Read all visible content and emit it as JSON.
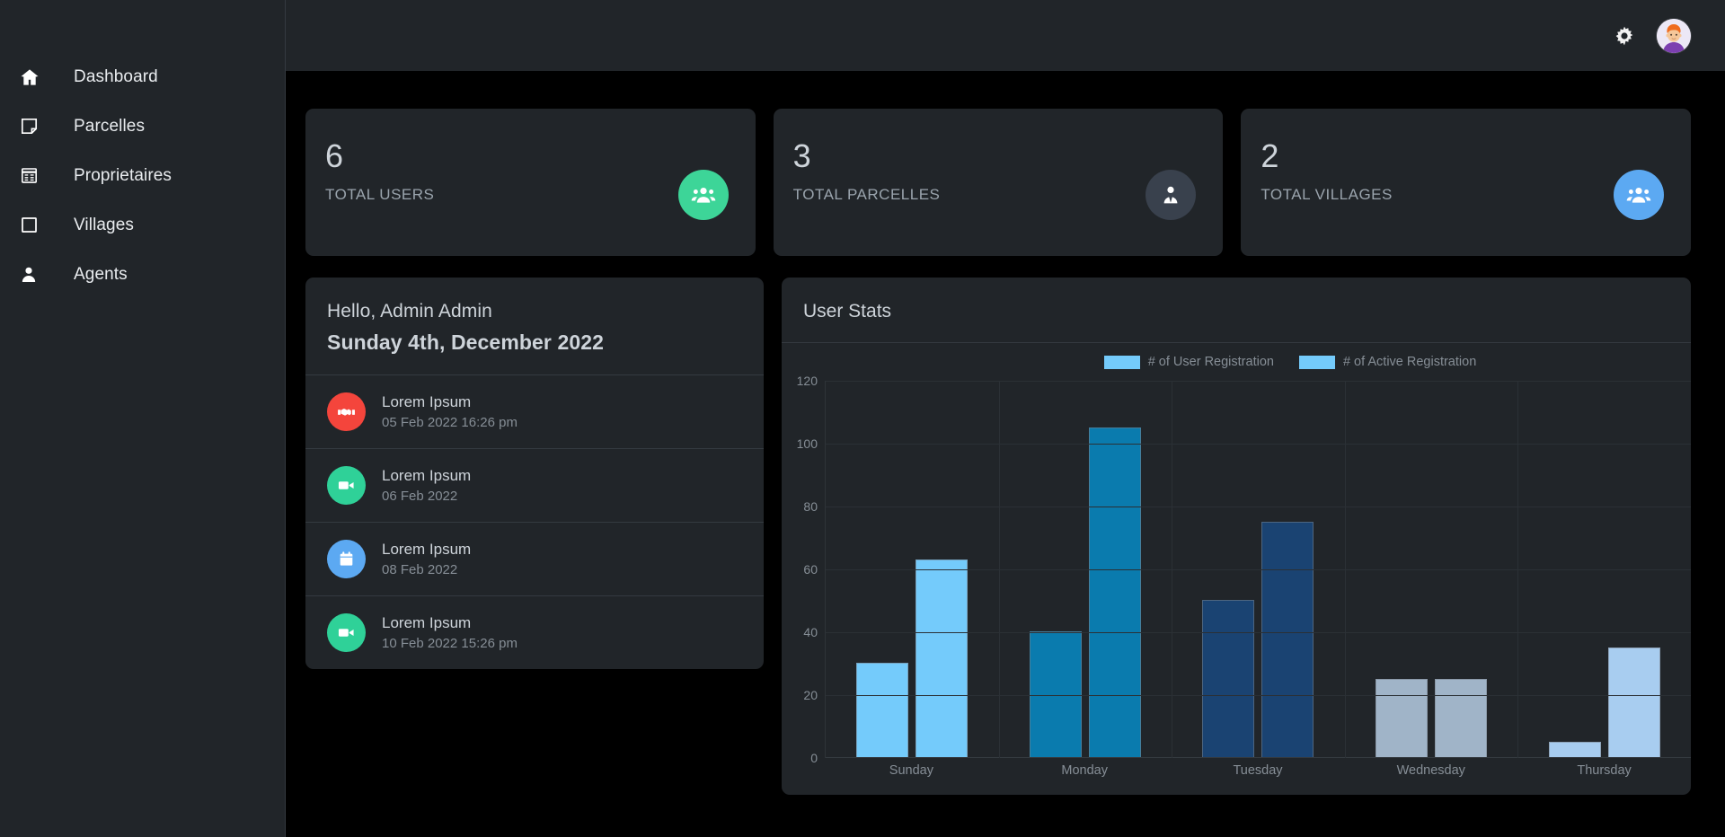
{
  "sidebar": {
    "items": [
      {
        "label": "Dashboard",
        "icon": "home-icon"
      },
      {
        "label": "Parcelles",
        "icon": "note-icon"
      },
      {
        "label": "Proprietaires",
        "icon": "list-card-icon"
      },
      {
        "label": "Villages",
        "icon": "square-icon"
      },
      {
        "label": "Agents",
        "icon": "person-icon"
      }
    ]
  },
  "topbar": {
    "gear_icon": "gear-icon",
    "avatar_icon": "user-avatar"
  },
  "stats": [
    {
      "value": "6",
      "label": "TOTAL USERS",
      "icon": "people-group-icon",
      "badge_color": "#3dd598",
      "icon_color": "#ffffff"
    },
    {
      "value": "3",
      "label": "TOTAL PARCELLES",
      "icon": "business-person-icon",
      "badge_color": "#39414d",
      "icon_color": "#ffffff"
    },
    {
      "value": "2",
      "label": "TOTAL VILLAGES",
      "icon": "people-group-icon",
      "badge_color": "#5ca9f2",
      "icon_color": "#ffffff"
    }
  ],
  "hello": {
    "greeting": "Hello, Admin Admin",
    "date": "Sunday 4th, December 2022",
    "activities": [
      {
        "title": "Lorem Ipsum",
        "time": "05 Feb 2022 16:26 pm",
        "icon": "handshake-icon",
        "badge_color": "#f4453c"
      },
      {
        "title": "Lorem Ipsum",
        "time": "06 Feb 2022",
        "icon": "video-camera-icon",
        "badge_color": "#2fd198"
      },
      {
        "title": "Lorem Ipsum",
        "time": "08 Feb 2022",
        "icon": "calendar-icon",
        "badge_color": "#5ca9f2"
      },
      {
        "title": "Lorem Ipsum",
        "time": "10 Feb 2022 15:26 pm",
        "icon": "video-camera-icon",
        "badge_color": "#2fd198"
      }
    ]
  },
  "chart_data": {
    "type": "bar",
    "title": "User Stats",
    "xlabel": "",
    "ylabel": "",
    "ylim": [
      0,
      120
    ],
    "yticks": [
      0,
      20,
      40,
      60,
      80,
      100,
      120
    ],
    "ytick_labels": [
      "0",
      "20",
      "40",
      "60",
      "80",
      "100",
      "120"
    ],
    "grid": true,
    "legend_position": "top-center",
    "categories": [
      "Sunday",
      "Monday",
      "Tuesday",
      "Wednesday",
      "Thursday"
    ],
    "series": [
      {
        "name": "# of User Registration",
        "values": [
          30,
          40,
          50,
          25,
          5
        ]
      },
      {
        "name": "# of Active Registration",
        "values": [
          63,
          105,
          75,
          25,
          35
        ]
      }
    ],
    "legend": [
      {
        "label": "# of User Registration",
        "color": "#74cbfb"
      },
      {
        "label": "# of Active Registration",
        "color": "#74cbfb"
      }
    ],
    "bar_colors_by_category": [
      {
        "category": "Sunday",
        "color": "#74cbfb"
      },
      {
        "category": "Monday",
        "color": "#0a7bae"
      },
      {
        "category": "Tuesday",
        "color": "#1a4372"
      },
      {
        "category": "Wednesday",
        "color": "#a0b4c8"
      },
      {
        "category": "Thursday",
        "color": "#a8cdf0"
      }
    ]
  },
  "colors": {
    "panel": "#212529",
    "page_bg": "#000000",
    "divider": "#343a40",
    "text_primary": "#ced4da",
    "text_muted": "#868e96"
  }
}
